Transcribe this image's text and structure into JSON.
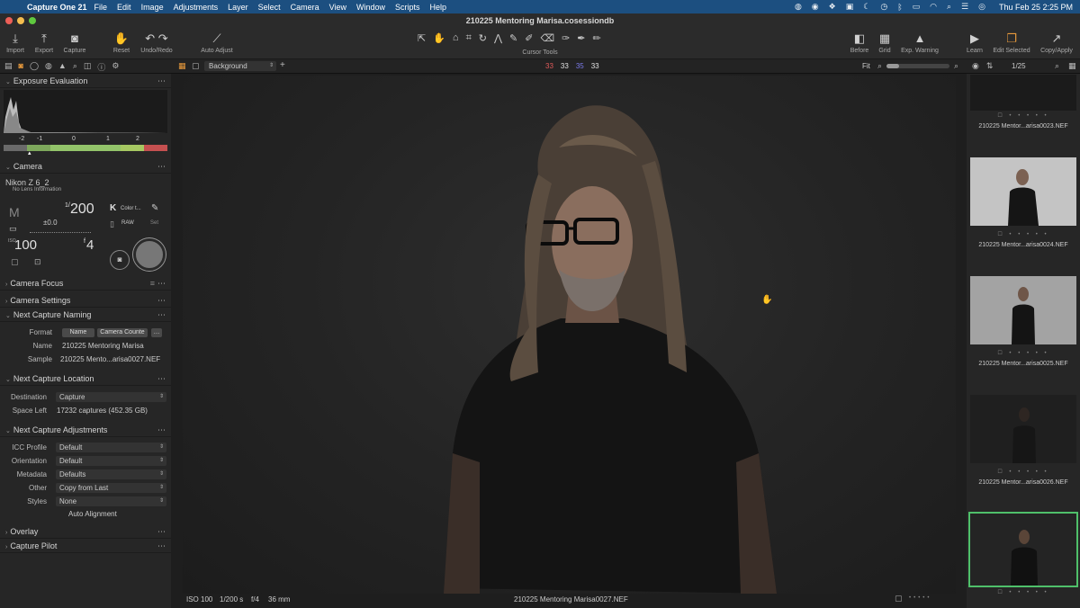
{
  "menubar": {
    "app_name": "Capture One 21",
    "menus": [
      "File",
      "Edit",
      "Image",
      "Adjustments",
      "Layer",
      "Select",
      "Camera",
      "View",
      "Window",
      "Scripts",
      "Help"
    ],
    "clock": "Thu Feb 25  2:25 PM"
  },
  "window": {
    "title": "210225 Mentoring Marisa.cosessiondb"
  },
  "toolbar": {
    "left": [
      {
        "label": "Import",
        "icon": "import-icon"
      },
      {
        "label": "Export",
        "icon": "export-icon"
      },
      {
        "label": "Capture",
        "icon": "camera-icon"
      },
      {
        "label": "Reset",
        "icon": "reset-icon"
      },
      {
        "label": "Undo/Redo",
        "icon": "undo-icon"
      },
      {
        "label": "Auto Adjust",
        "icon": "magic-wand-icon"
      }
    ],
    "cursor_tools_label": "Cursor Tools",
    "right": [
      {
        "label": "Before",
        "icon": "before-after-icon"
      },
      {
        "label": "Grid",
        "icon": "grid-icon"
      },
      {
        "label": "Exp. Warning",
        "icon": "warning-icon"
      },
      {
        "label": "Learn",
        "icon": "play-icon"
      },
      {
        "label": "Edit Selected",
        "icon": "edit-selected-icon"
      },
      {
        "label": "Copy/Apply",
        "icon": "copy-apply-icon"
      }
    ]
  },
  "subbar": {
    "layer": "Background",
    "readouts": [
      "33",
      "33",
      "35",
      "33"
    ],
    "readout_colors": [
      "#e05a5a",
      "#e0e0e0",
      "#7a7ae8",
      "#e0e0e0"
    ],
    "zoom": "Fit",
    "zoom_level": 0.2,
    "counter": "1/25"
  },
  "panels": {
    "exposure": "Exposure Evaluation",
    "ev_scale": [
      "-2",
      "-1",
      "0",
      "1",
      "2"
    ],
    "camera": "Camera",
    "camera_model": "Nikon Z 6_2",
    "lens": "No Lens Information",
    "mode": "M",
    "shutter_num": "1/",
    "shutter": "200",
    "ev": "±0.0",
    "iso_label": "ISO",
    "iso": "100",
    "aperture_f": "f",
    "aperture": "4",
    "color_label": "Color t...",
    "raw_label": "RAW",
    "set_label": "Set",
    "camera_focus": "Camera Focus",
    "camera_settings": "Camera Settings",
    "next_naming": "Next Capture Naming",
    "format_label": "Format",
    "format_tokens": [
      "Name",
      "Camera Counte"
    ],
    "name_label": "Name",
    "name_value": "210225 Mentoring Marisa",
    "sample_label": "Sample",
    "sample_value": "210225 Mento...arisa0027.NEF",
    "next_location": "Next Capture Location",
    "destination_label": "Destination",
    "destination_value": "Capture",
    "space_label": "Space Left",
    "space_value": "17232 captures (452.35 GB)",
    "next_adjust": "Next Capture Adjustments",
    "icc_label": "ICC Profile",
    "icc_value": "Default",
    "orientation_label": "Orientation",
    "orientation_value": "Default",
    "metadata_label": "Metadata",
    "metadata_value": "Defaults",
    "other_label": "Other",
    "other_value": "Copy from Last",
    "styles_label": "Styles",
    "styles_value": "None",
    "auto_alignment": "Auto Alignment",
    "overlay": "Overlay",
    "capture_pilot": "Capture Pilot"
  },
  "viewer": {
    "iso": "ISO 100",
    "shutter": "1/200 s",
    "aperture": "f/4",
    "focal": "36 mm",
    "filename": "210225 Mentoring Marisa0027.NEF"
  },
  "filmstrip": [
    {
      "name": "210225 Mentor...arisa0023.NEF",
      "bg": "#101010"
    },
    {
      "name": "210225 Mentor...arisa0024.NEF",
      "bg": "#bdbdbd"
    },
    {
      "name": "210225 Mentor...arisa0025.NEF",
      "bg": "#9e9e9e"
    },
    {
      "name": "210225 Mentor...arisa0026.NEF",
      "bg": "#1e1e1e"
    },
    {
      "name": "",
      "bg": "#222222"
    }
  ],
  "colors": {
    "accent": "#e89a3c",
    "selection": "#4fc06a",
    "menubar": "#1c4f80"
  }
}
